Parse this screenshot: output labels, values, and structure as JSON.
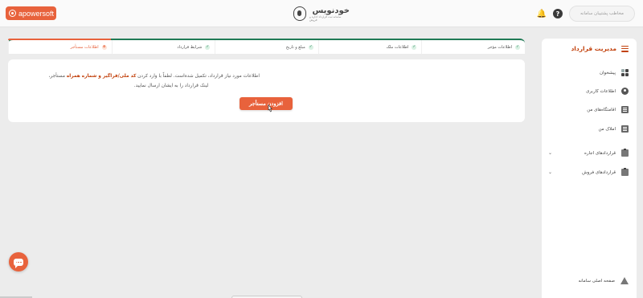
{
  "header": {
    "user_placeholder": "مخاطب پشتیبان سامانه",
    "help_glyph": "?",
    "bell_glyph": "🔔",
    "logo_title": "خودنویس",
    "logo_subtitle": "سامانه ثبت قرارداد اجاره و فروش",
    "recording_label": "apowersoft",
    "accent_color": "#e8623c"
  },
  "sidebar": {
    "title": "مدیریت قرارداد",
    "items": [
      {
        "label": "پیشخوان",
        "icon": "dashboard-grid-icon"
      },
      {
        "label": "اطلاعات کاربری",
        "icon": "user-icon"
      },
      {
        "label": "اقامتگاه‌های من",
        "icon": "building-icon"
      },
      {
        "label": "املاک من",
        "icon": "building-icon"
      },
      {
        "label": "قراردادهای اجاره",
        "icon": "clipboard-icon",
        "expandable": true
      },
      {
        "label": "قراردادهای فروش",
        "icon": "clipboard-icon",
        "expandable": true
      }
    ],
    "footer_item": {
      "label": "صفحه اصلی سامانه",
      "icon": "home-icon"
    }
  },
  "stepper": {
    "steps": [
      {
        "label": "اطلاعات مؤجر",
        "status": "done",
        "mark": "✓"
      },
      {
        "label": "اطلاعات ملک",
        "status": "done",
        "mark": "✓"
      },
      {
        "label": "مبلغ و تاریخ",
        "status": "done",
        "mark": "✓"
      },
      {
        "label": "شرایط قرارداد",
        "status": "done",
        "mark": "✓"
      },
      {
        "label": "اطلاعات مستأجر",
        "status": "active",
        "mark": "۵"
      }
    ],
    "done_color": "#1f7a55",
    "active_color": "#e8623c"
  },
  "main": {
    "message_part1": "اطلاعات مورد نیاز قرارداد، تکمیل شده‌است. لطفاً با وارد کردن ",
    "message_highlight": "کد ملی/فراگیر و شماره همراه",
    "message_part2": " مستأجر،",
    "message_line2": "لینک قرارداد را به ایشان ارسال نمایید.",
    "add_button_label": "افزودن مستأجر"
  }
}
